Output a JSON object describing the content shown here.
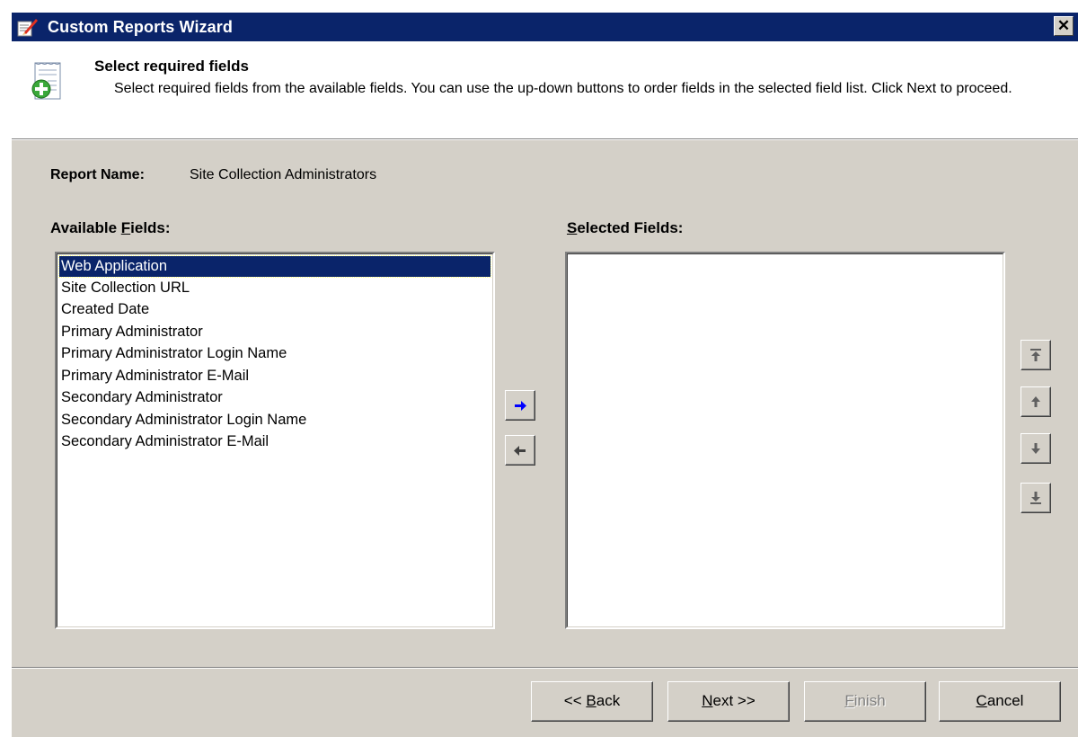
{
  "window": {
    "title": "Custom Reports Wizard",
    "close_glyph": "✕"
  },
  "header": {
    "title": "Select required fields",
    "description": "Select required fields from the available fields. You can use the up-down buttons to order fields in the selected field list. Click Next to proceed."
  },
  "report": {
    "label": "Report Name:",
    "value": "Site Collection Administrators"
  },
  "available": {
    "label_prefix": "Available ",
    "label_accel": "F",
    "label_suffix": "ields:",
    "items": [
      "Web Application",
      "Site Collection URL",
      "Created Date",
      "Primary Administrator",
      "Primary Administrator Login Name",
      "Primary Administrator E-Mail",
      "Secondary Administrator",
      "Secondary Administrator Login Name",
      "Secondary Administrator E-Mail"
    ],
    "selected_item": "Web Application"
  },
  "selected": {
    "label_accel": "S",
    "label_suffix": "elected Fields:",
    "items": []
  },
  "buttons": {
    "back_prefix": "<< ",
    "back_accel": "B",
    "back_suffix": "ack",
    "next_accel": "N",
    "next_suffix": "ext >>",
    "finish_accel": "F",
    "finish_suffix": "inish",
    "cancel_accel": "C",
    "cancel_suffix": "ancel",
    "finish_enabled": false
  },
  "icons": {
    "title": "report-wizard-icon",
    "header": "add-report-icon",
    "add": "arrow-right-icon",
    "remove": "arrow-left-icon",
    "move_top": "move-top-icon",
    "move_up": "arrow-up-icon",
    "move_down": "arrow-down-icon",
    "move_bottom": "move-bottom-icon"
  },
  "colors": {
    "titlebar": "#0a246a",
    "dialog_face": "#d4d0c8",
    "selection": "#0a246a",
    "add_arrow": "#0000ff"
  }
}
